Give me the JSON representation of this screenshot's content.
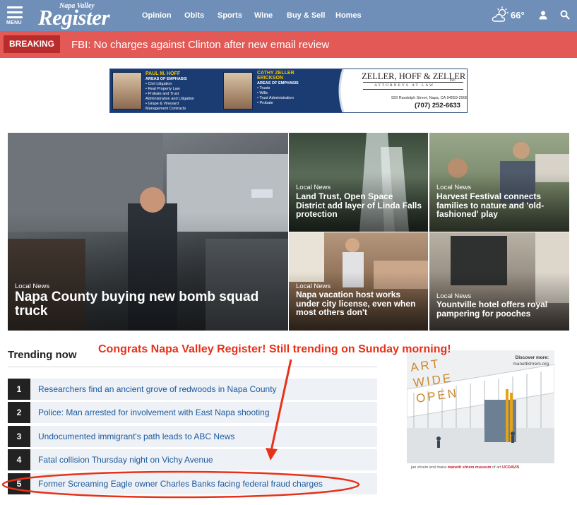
{
  "nav": {
    "menu_label": "MENU",
    "logo_top": "Napa Valley",
    "logo_main": "Register",
    "links": [
      "Opinion",
      "Obits",
      "Sports",
      "Wine",
      "Buy & Sell",
      "Homes"
    ],
    "temperature": "66°"
  },
  "breaking": {
    "badge": "BREAKING",
    "headline": "FBI: No charges against Clinton after new email review"
  },
  "ad_banner": {
    "attorney1_name": "PAUL M. HOFF",
    "attorney1_emphasis": "AREAS OF EMPHASIS",
    "attorney1_areas": [
      "• Civil Litigation",
      "• Real Property Law",
      "• Probate and Trust",
      "   Administration and Litigation",
      "• Grape & Vineyard",
      "   Management Contracts"
    ],
    "attorney2_name_line1": "CATHY ZELLER",
    "attorney2_name_line2": "ERICKSON",
    "attorney2_emphasis": "AREAS OF EMPHASIS",
    "attorney2_areas": [
      "• Trusts",
      "• Wills",
      "• Trust Administration",
      "• Probate"
    ],
    "firm": "ZELLER, HOFF & ZELLER",
    "firm_suffix": "INC.",
    "tagline": "ATTORNEYS AT LAW",
    "address": "929 Randolph Street, Napa, CA 94559-2908",
    "phone": "(707) 252-6633"
  },
  "stories": [
    {
      "category": "Local News",
      "headline": "Napa County buying new bomb squad truck"
    },
    {
      "category": "Local News",
      "headline": "Land Trust, Open Space District add layer of Linda Falls protection"
    },
    {
      "category": "Local News",
      "headline": "Harvest Festival connects families to nature and 'old-fashioned' play"
    },
    {
      "category": "Local News",
      "headline": "Napa vacation host works under city license, even when most others don't"
    },
    {
      "category": "Local News",
      "headline": "Yountville hotel offers royal pampering for pooches"
    }
  ],
  "trending": {
    "title": "Trending now",
    "items": [
      {
        "rank": "1",
        "title": "Researchers find an ancient grove of redwoods in Napa County"
      },
      {
        "rank": "2",
        "title": "Police: Man arrested for involvement with East Napa shooting"
      },
      {
        "rank": "3",
        "title": "Undocumented immigrant's path leads to ABC News"
      },
      {
        "rank": "4",
        "title": "Fatal collision Thursday night on Vichy Avenue"
      },
      {
        "rank": "5",
        "title": "Former Screaming Eagle owner Charles Banks facing federal fraud charges"
      }
    ]
  },
  "annotation": "Congrats Napa Valley Register! Still trending on Sunday morning!",
  "side_ad": {
    "discover_label": "Discover more:",
    "discover_url": "manettishrem.org",
    "art_text": "ART WIDE OPEN",
    "footer_prefix": "jan shrem and maria",
    "footer_brand": "manetti shrem museum",
    "footer_suffix": "of art",
    "footer_org": "UCDAVIS"
  },
  "colors": {
    "nav_bg": "#6f8fb8",
    "breaking_bg": "#e25956",
    "breaking_badge": "#b92c2c",
    "link_blue": "#1b5aa0",
    "annotation_red": "#e63219"
  }
}
